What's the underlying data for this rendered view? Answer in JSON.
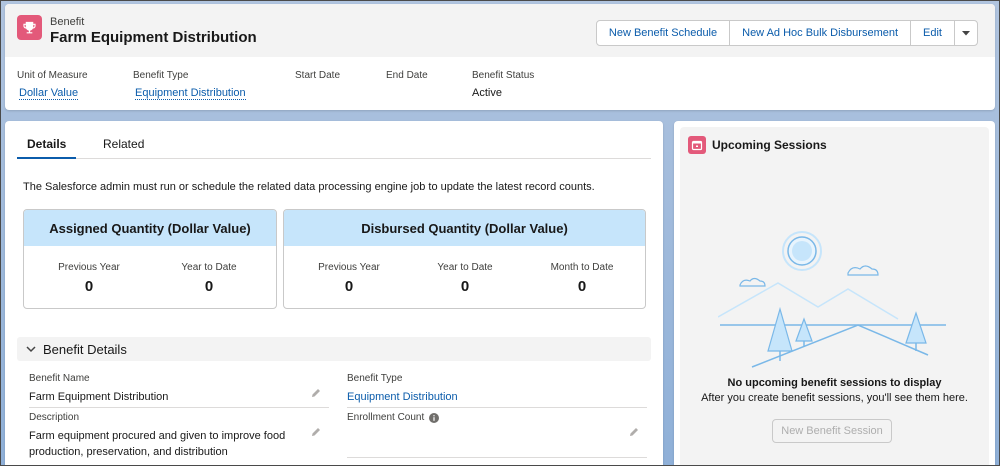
{
  "header": {
    "object_label": "Benefit",
    "title": "Farm Equipment Distribution",
    "actions": [
      "New Benefit Schedule",
      "New Ad Hoc Bulk Disbursement",
      "Edit"
    ],
    "icon": "trophy-icon",
    "icon_color": "#e3597a"
  },
  "highlights": [
    {
      "label": "Unit of Measure",
      "value": "Dollar Value",
      "link": true
    },
    {
      "label": "Benefit Type",
      "value": "Equipment Distribution",
      "link": true
    },
    {
      "label": "Start Date",
      "value": "",
      "link": false
    },
    {
      "label": "End Date",
      "value": "",
      "link": false
    },
    {
      "label": "Benefit Status",
      "value": "Active",
      "link": false
    }
  ],
  "tabs": [
    "Details",
    "Related"
  ],
  "notice": "The Salesforce admin must run or schedule the related data processing engine job to update the latest record counts.",
  "assigned": {
    "title": "Assigned Quantity (Dollar Value)",
    "cols": [
      {
        "label": "Previous Year",
        "value": "0"
      },
      {
        "label": "Year to Date",
        "value": "0"
      }
    ]
  },
  "disbursed": {
    "title": "Disbursed Quantity (Dollar Value)",
    "cols": [
      {
        "label": "Previous Year",
        "value": "0"
      },
      {
        "label": "Year to Date",
        "value": "0"
      },
      {
        "label": "Month to Date",
        "value": "0"
      }
    ]
  },
  "section": {
    "title": "Benefit Details",
    "fields": {
      "benefit_name": {
        "label": "Benefit Name",
        "value": "Farm Equipment Distribution"
      },
      "benefit_type": {
        "label": "Benefit Type",
        "value": "Equipment Distribution"
      },
      "description": {
        "label": "Description",
        "value_line1": "Farm equipment procured and given to improve food",
        "value_line2": "production, preservation, and distribution"
      },
      "enrollment_count": {
        "label": "Enrollment Count",
        "value": ""
      }
    }
  },
  "sessions": {
    "title": "Upcoming Sessions",
    "empty_title": "No upcoming benefit sessions to display",
    "empty_sub": "After you create benefit sessions, you'll see them here.",
    "button": "New Benefit Session"
  },
  "colors": {
    "accent": "#0b5cab",
    "card_header": "#c6e5fb",
    "icon_pink": "#e3597a"
  }
}
